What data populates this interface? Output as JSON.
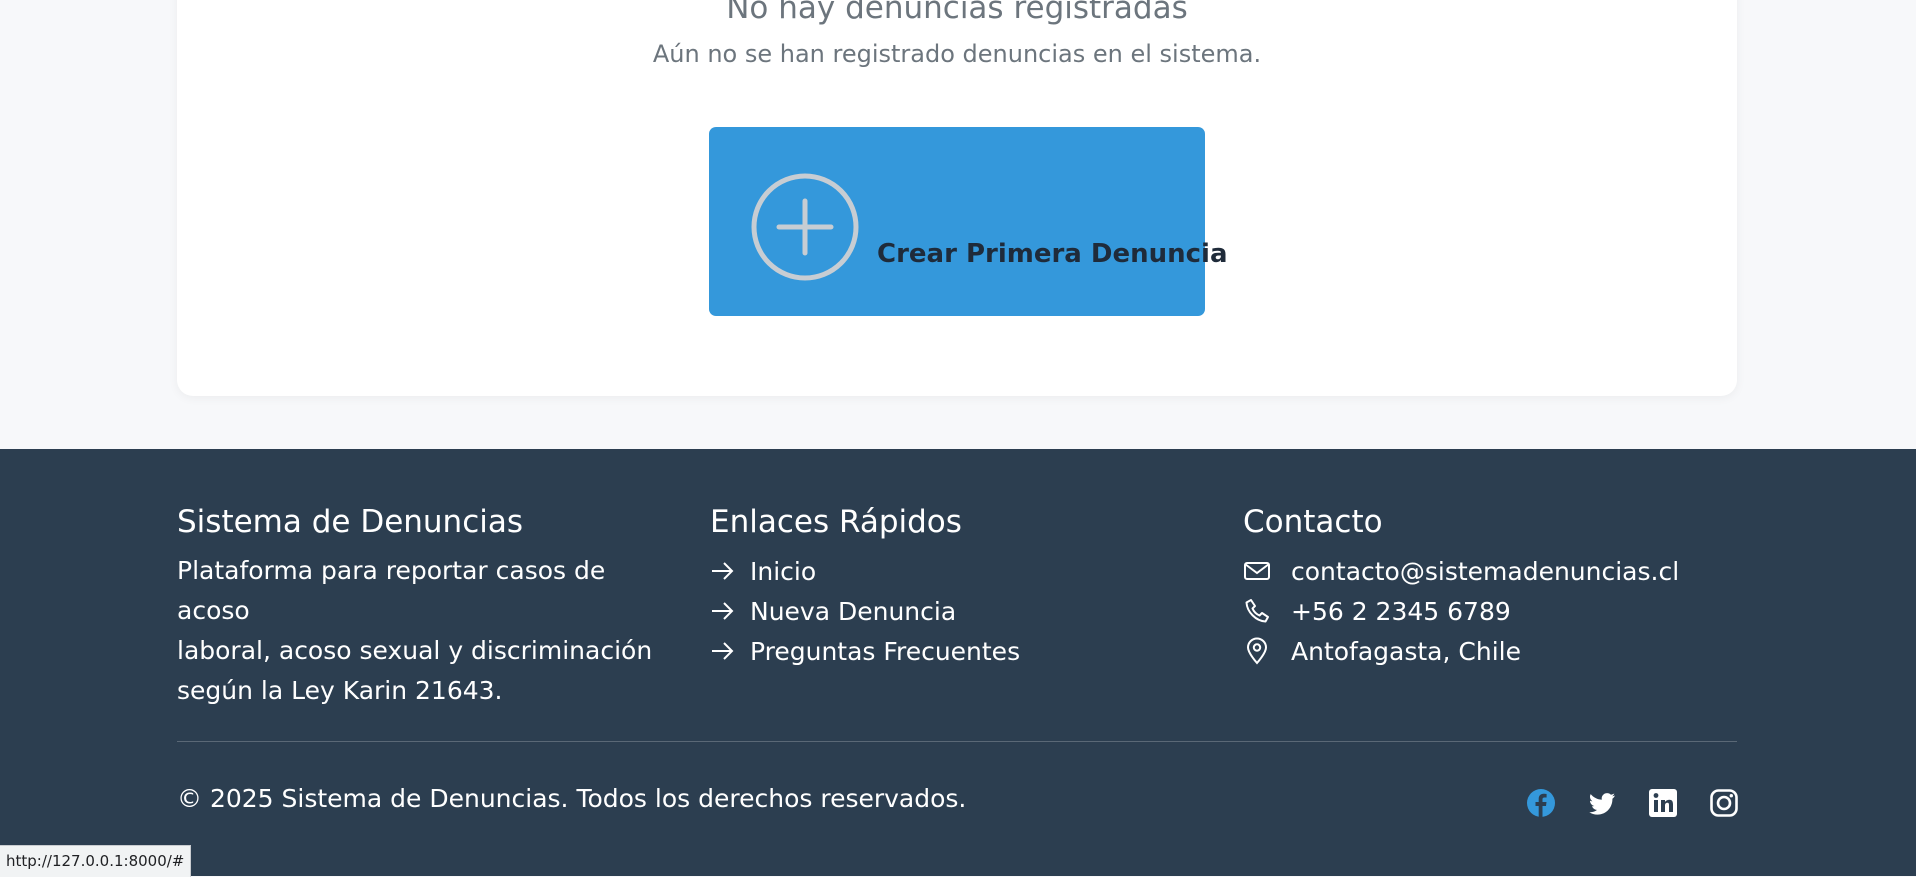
{
  "empty_state": {
    "title": "No hay denuncias registradas",
    "subtitle": "Aún no se han registrado denuncias en el sistema.",
    "button_label": "Crear Primera Denuncia",
    "button_color": "#3498db"
  },
  "footer": {
    "background": "#2c3e50",
    "about": {
      "heading": "Sistema de Denuncias",
      "text_lines": [
        "Plataforma para reportar casos de acoso",
        "laboral, acoso sexual y discriminación",
        "según la Ley Karin 21643."
      ]
    },
    "links": {
      "heading": "Enlaces Rápidos",
      "items": [
        {
          "label": "Inicio",
          "icon": "arrow-right-icon"
        },
        {
          "label": "Nueva Denuncia",
          "icon": "arrow-right-icon"
        },
        {
          "label": "Preguntas Frecuentes",
          "icon": "arrow-right-icon"
        }
      ]
    },
    "contact": {
      "heading": "Contacto",
      "email": "contacto@sistemadenuncias.cl",
      "phone": "+56 2 2345 6789",
      "location": "Antofagasta, Chile"
    },
    "copyright": "© 2025 Sistema de Denuncias. Todos los derechos reservados.",
    "social": [
      {
        "name": "facebook-icon",
        "color": "#3498db"
      },
      {
        "name": "twitter-icon",
        "color": "#ffffff"
      },
      {
        "name": "linkedin-icon",
        "color": "#ffffff"
      },
      {
        "name": "instagram-icon",
        "color": "#ffffff"
      }
    ]
  },
  "status_bar": {
    "url": "http://127.0.0.1:8000/#"
  }
}
